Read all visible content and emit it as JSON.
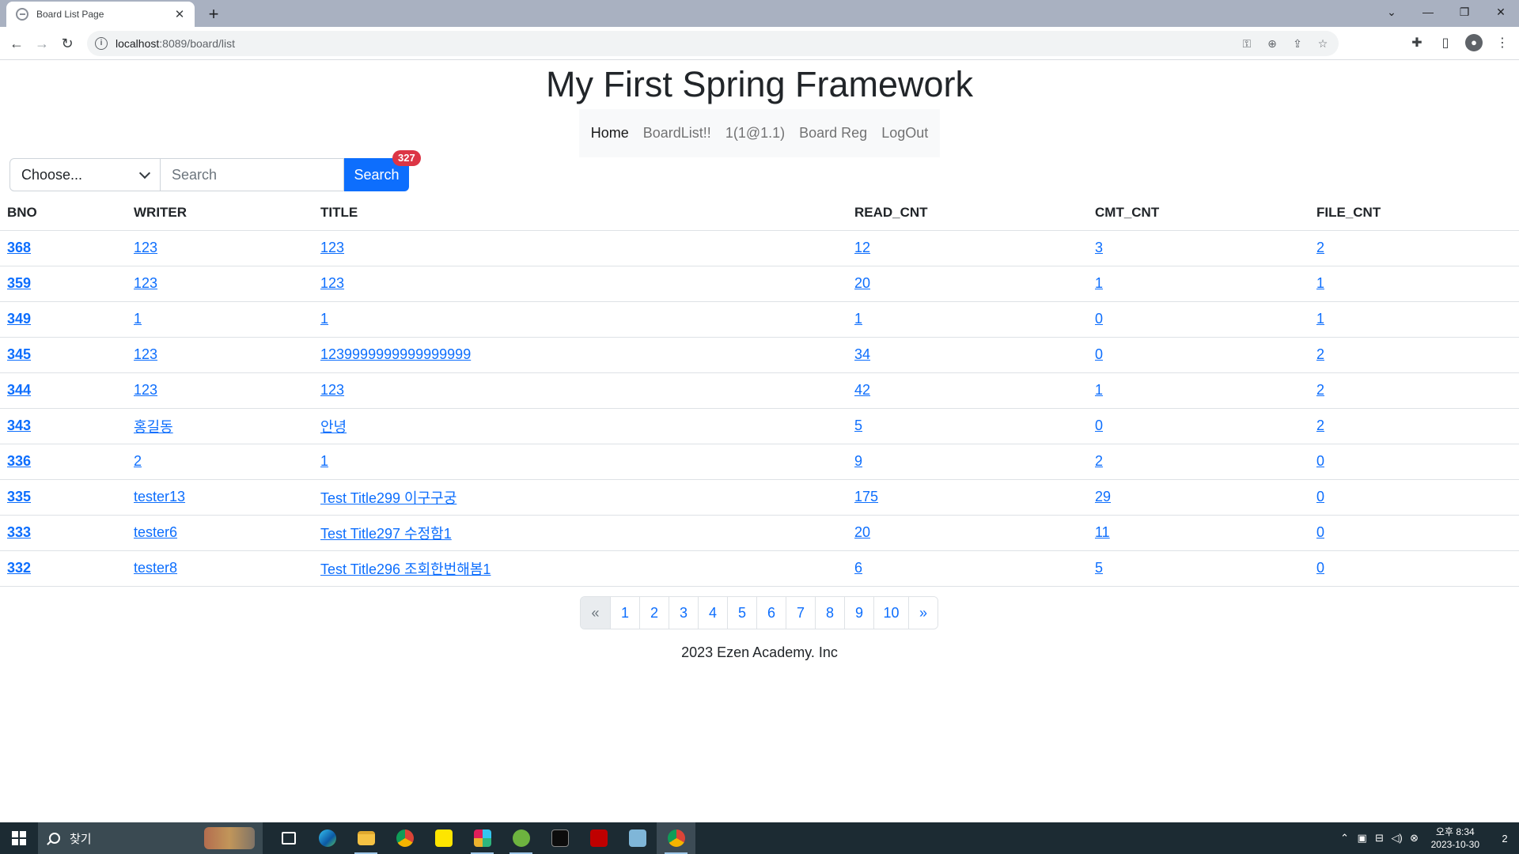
{
  "browser": {
    "tab_title": "Board List Page",
    "tab_close": "✕",
    "new_tab": "+",
    "url_host": "localhost",
    "url_rest": ":8089/board/list",
    "window_controls": {
      "dropdown": "⌄",
      "minimize": "—",
      "restore": "❐",
      "close": "✕"
    },
    "nav": {
      "back": "←",
      "forward": "→",
      "reload": "↻"
    }
  },
  "site": {
    "title": "My First Spring Framework",
    "nav": [
      {
        "label": "Home",
        "active": true
      },
      {
        "label": "BoardList!!",
        "active": false
      },
      {
        "label": "1(1@1.1)",
        "active": false
      },
      {
        "label": "Board Reg",
        "active": false
      },
      {
        "label": "LogOut",
        "active": false
      }
    ]
  },
  "search": {
    "select_value": "Choose...",
    "placeholder": "Search",
    "button_label": "Search",
    "badge_count": "327"
  },
  "table": {
    "columns": [
      "BNO",
      "WRITER",
      "TITLE",
      "READ_CNT",
      "CMT_CNT",
      "FILE_CNT"
    ],
    "rows": [
      [
        "368",
        "123",
        "123",
        "12",
        "3",
        "2"
      ],
      [
        "359",
        "123",
        "123",
        "20",
        "1",
        "1"
      ],
      [
        "349",
        "1",
        "1",
        "1",
        "0",
        "1"
      ],
      [
        "345",
        "123",
        "1239999999999999999",
        "34",
        "0",
        "2"
      ],
      [
        "344",
        "123",
        "123",
        "42",
        "1",
        "2"
      ],
      [
        "343",
        "홍길동",
        "안녕",
        "5",
        "0",
        "2"
      ],
      [
        "336",
        "2",
        "1",
        "9",
        "2",
        "0"
      ],
      [
        "335",
        "tester13",
        "Test Title299 이구구궁",
        "175",
        "29",
        "0"
      ],
      [
        "333",
        "tester6",
        "Test Title297 수정함1",
        "20",
        "11",
        "0"
      ],
      [
        "332",
        "tester8",
        "Test Title296 조회한번해봄1",
        "6",
        "5",
        "0"
      ]
    ]
  },
  "pagination": {
    "prev": "«",
    "pages": [
      "1",
      "2",
      "3",
      "4",
      "5",
      "6",
      "7",
      "8",
      "9",
      "10"
    ],
    "next": "»"
  },
  "footer": {
    "text": "2023 Ezen Academy. Inc"
  },
  "taskbar": {
    "search_text": "찾기",
    "clock_ampm_time": "오후 8:34",
    "clock_date": "2023-10-30",
    "notification_count": "2"
  }
}
